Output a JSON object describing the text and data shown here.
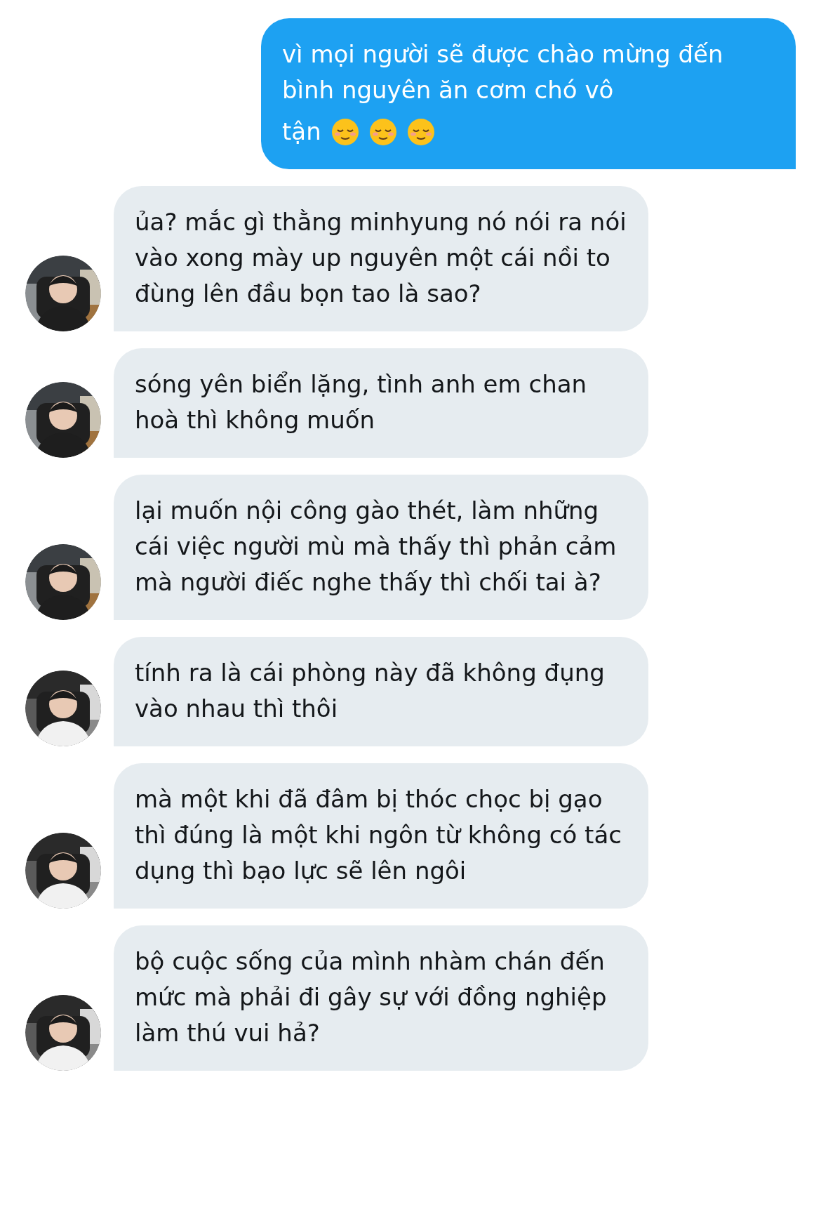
{
  "messages": [
    {
      "kind": "sent",
      "text": "vì mọi người sẽ được chào mừng đến bình nguyên ăn cơm chó vô",
      "tail": {
        "text": "tận",
        "emojis": [
          {
            "kind": "relieved-face"
          },
          {
            "kind": "relieved-face"
          },
          {
            "kind": "relieved-face"
          }
        ]
      }
    },
    {
      "kind": "received",
      "text": "ủa? mắc gì thằng minhyung nó nói ra nói vào xong mày up nguyên một cái nồi to đùng lên đầu bọn tao là sao?"
    },
    {
      "kind": "received",
      "text": "sóng yên biển lặng, tình anh em chan hoà thì không muốn"
    },
    {
      "kind": "received",
      "text": "lại muốn nội công gào thét, làm những cái việc người mù mà thấy thì phản cảm mà người điếc nghe thấy thì chối tai à?"
    },
    {
      "kind": "received",
      "text": "tính ra là cái phòng này đã không đụng vào nhau thì thôi"
    },
    {
      "kind": "received",
      "text": "mà một khi đã đâm bị thóc chọc bị gạo thì đúng là một khi ngôn từ không có tác dụng thì bạo lực sẽ lên ngôi"
    },
    {
      "kind": "received",
      "text": "bộ cuộc sống của mình nhàm chán đến mức mà phải đi gây sự với đồng nghiệp làm thú vui hả?"
    }
  ]
}
